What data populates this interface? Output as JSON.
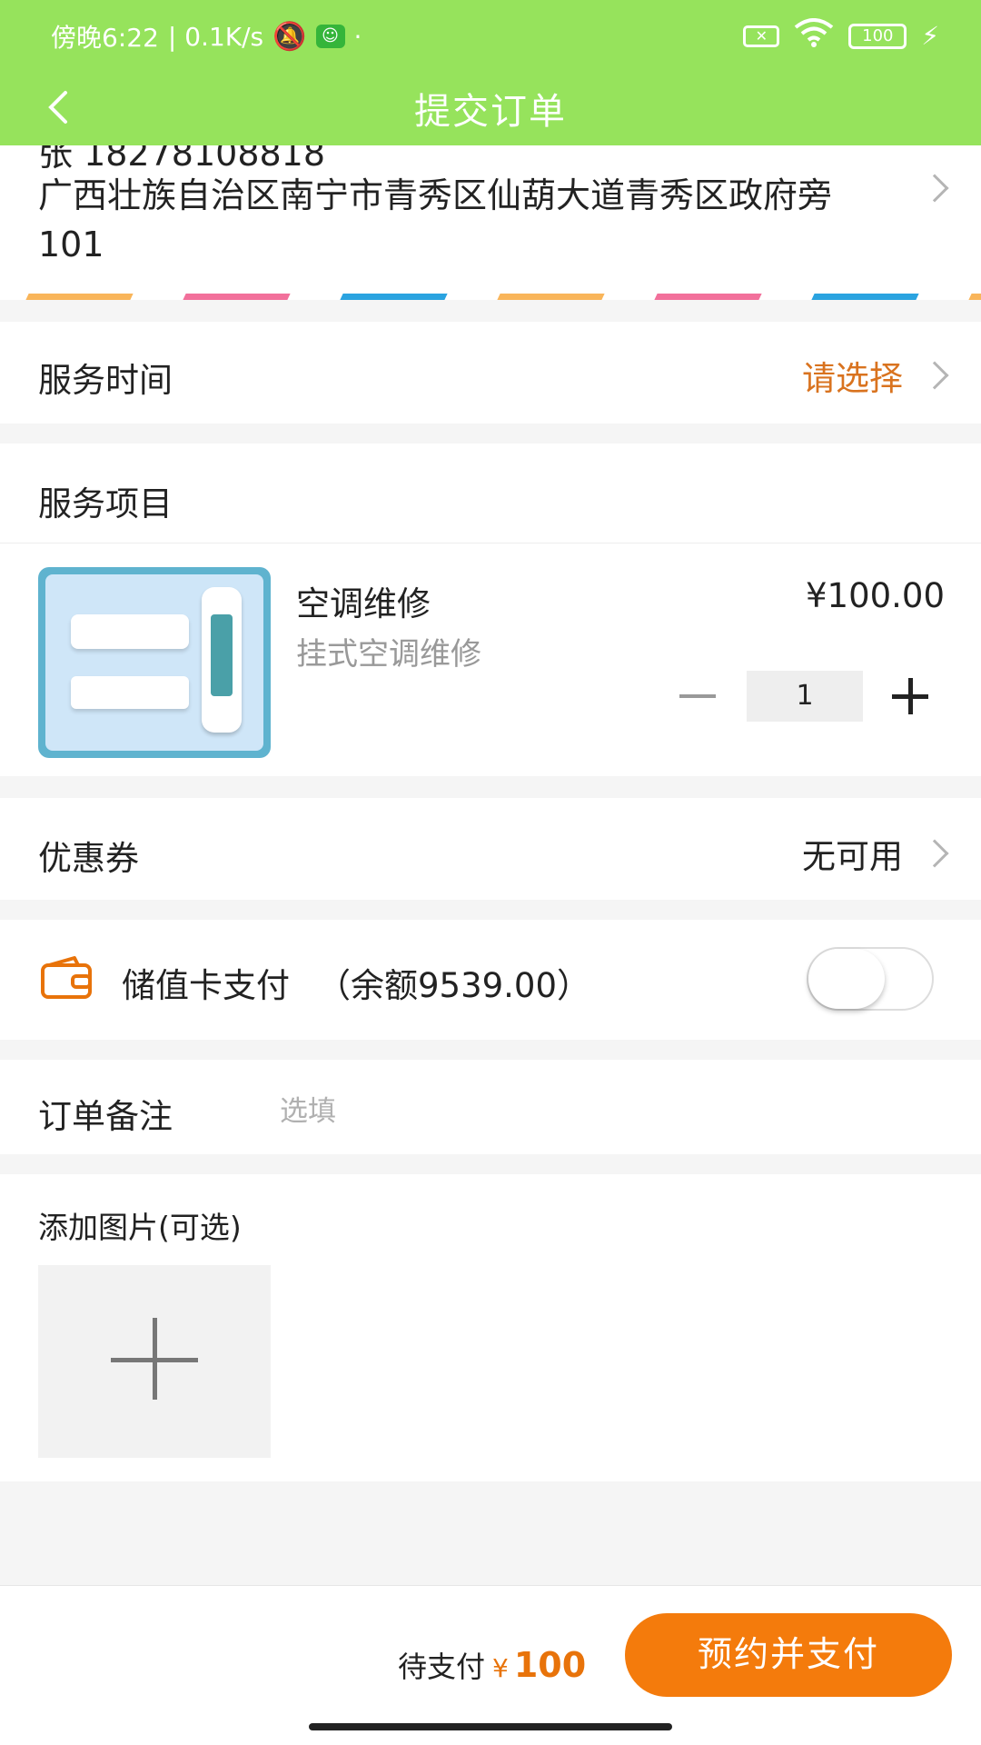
{
  "status_bar": {
    "time": "傍晚6:22",
    "network_speed": "| 0.1K/s",
    "dot": "·",
    "battery": "100"
  },
  "nav": {
    "title": "提交订单"
  },
  "address": {
    "name_phone": "张 18278108818",
    "text": "广西壮族自治区南宁市青秀区仙葫大道青秀区政府旁101"
  },
  "service_time": {
    "label": "服务时间",
    "value": "请选择"
  },
  "service_items": {
    "header": "服务项目",
    "item": {
      "title": "空调维修",
      "subtitle": "挂式空调维修",
      "price": "¥100.00",
      "quantity": "1"
    }
  },
  "coupon": {
    "label": "优惠券",
    "value": "无可用"
  },
  "stored_card": {
    "label": "储值卡支付",
    "balance": "（余额9539.00）",
    "enabled": false
  },
  "remark": {
    "label": "订单备注",
    "placeholder": "选填"
  },
  "photos": {
    "label": "添加图片(可选)"
  },
  "footer": {
    "pending_label": "待支付",
    "currency": "¥",
    "amount": "100",
    "submit_label": "预约并支付"
  },
  "colors": {
    "header_green": "#96e35c",
    "accent_orange": "#f47b0c",
    "select_text": "#d9731f"
  }
}
